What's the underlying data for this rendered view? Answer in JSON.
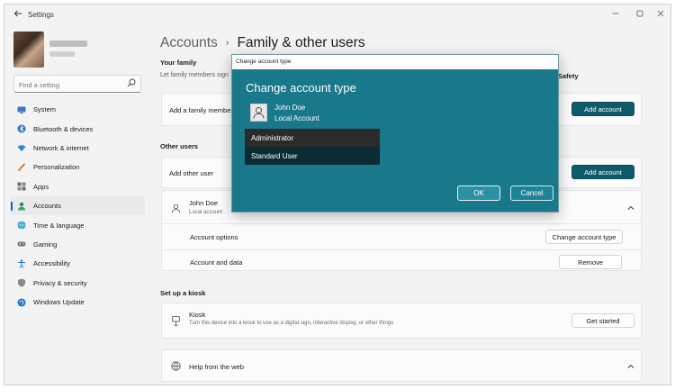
{
  "window": {
    "title": "Settings"
  },
  "sidebar": {
    "search_placeholder": "Find a setting",
    "items": [
      {
        "label": "System",
        "icon": "monitor-icon",
        "active": false
      },
      {
        "label": "Bluetooth & devices",
        "icon": "bluetooth-icon",
        "active": false
      },
      {
        "label": "Network & internet",
        "icon": "wifi-icon",
        "active": false
      },
      {
        "label": "Personalization",
        "icon": "brush-icon",
        "active": false
      },
      {
        "label": "Apps",
        "icon": "apps-icon",
        "active": false
      },
      {
        "label": "Accounts",
        "icon": "person-icon",
        "active": true
      },
      {
        "label": "Time & language",
        "icon": "globe-icon",
        "active": false
      },
      {
        "label": "Gaming",
        "icon": "controller-icon",
        "active": false
      },
      {
        "label": "Accessibility",
        "icon": "accessibility-icon",
        "active": false
      },
      {
        "label": "Privacy & security",
        "icon": "shield-icon",
        "active": false
      },
      {
        "label": "Windows Update",
        "icon": "update-icon",
        "active": false
      }
    ]
  },
  "header": {
    "parent": "Accounts",
    "separator": "›",
    "current": "Family & other users"
  },
  "family": {
    "title": "Your family",
    "desc": "Let family members sign",
    "safety_label": "Safety",
    "add_label": "Add a family member",
    "add_button": "Add account"
  },
  "other_users": {
    "title": "Other users",
    "add_label": "Add other user",
    "add_button": "Add account",
    "user_name": "John Doe",
    "user_type": "Local account",
    "options_label": "Account options",
    "options_button": "Change account type",
    "data_label": "Account and data",
    "data_button": "Remove"
  },
  "kiosk": {
    "title": "Set up a kiosk",
    "label": "Kiosk",
    "desc": "Turn this device into a kiosk to use as a digital sign, interactive display, or other things",
    "button": "Get started"
  },
  "help": {
    "label": "Help from the web"
  },
  "dialog": {
    "window_title": "Change account type",
    "heading": "Change account type",
    "user_name": "John Doe",
    "user_type": "Local Account",
    "options": [
      "Administrator",
      "Standard User"
    ],
    "selected": "Standard User",
    "ok": "OK",
    "cancel": "Cancel"
  },
  "colors": {
    "accent": "#0f5a6a",
    "dialog_bg": "#19788a",
    "nav_indicator": "#0067c0"
  }
}
